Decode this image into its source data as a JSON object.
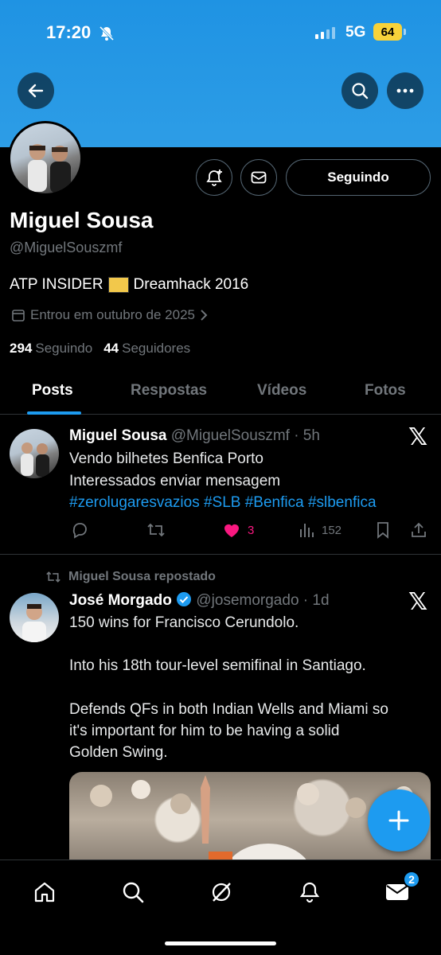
{
  "status_bar": {
    "time": "17:20",
    "network": "5G",
    "battery": "64"
  },
  "profile": {
    "follow_button": "Seguindo",
    "name": "Miguel Sousa",
    "handle": "@MiguelSouszmf",
    "bio_prefix": "ATP INSIDER",
    "bio_suffix": "Dreamhack 2016",
    "joined": "Entrou em outubro de 2025",
    "following_count": "294",
    "following_label": "Seguindo",
    "followers_count": "44",
    "followers_label": "Seguidores"
  },
  "tabs": [
    "Posts",
    "Respostas",
    "Vídeos",
    "Fotos"
  ],
  "tweet1": {
    "name": "Miguel Sousa",
    "handle_time": "@MiguelSouszmf · 5h",
    "line1": "Vendo bilhetes Benfica Porto",
    "line2": "Interessados enviar mensagem",
    "hashtags": "#zerolugaresvazios #SLB #Benfica #slbenfica",
    "likes": "3",
    "views": "152"
  },
  "tweet2": {
    "repost_label": "Miguel Sousa repostado",
    "name": "José Morgado",
    "handle_time": "@josemorgado · 1d",
    "line1": "150 wins for Francisco Cerundolo.",
    "line2": "Into his 18th tour-level semifinal in Santiago.",
    "line3": "Defends QFs in both Indian Wells and Miami so",
    "line4": "it's important for him to be having a solid",
    "line5": "Golden Swing."
  },
  "nav": {
    "messages_badge": "2"
  },
  "colors": {
    "accent": "#1d9bf0",
    "like": "#f91880",
    "banner": "#2d9de6"
  },
  "icons": [
    "back-arrow-icon",
    "search-icon",
    "more-icon",
    "bell-plus-icon",
    "mail-icon",
    "calendar-icon",
    "reply-icon",
    "repost-icon",
    "heart-icon",
    "views-icon",
    "bookmark-icon",
    "share-icon",
    "x-logo-icon",
    "verified-icon",
    "plus-icon",
    "home-icon",
    "grok-icon",
    "notifications-icon"
  ]
}
